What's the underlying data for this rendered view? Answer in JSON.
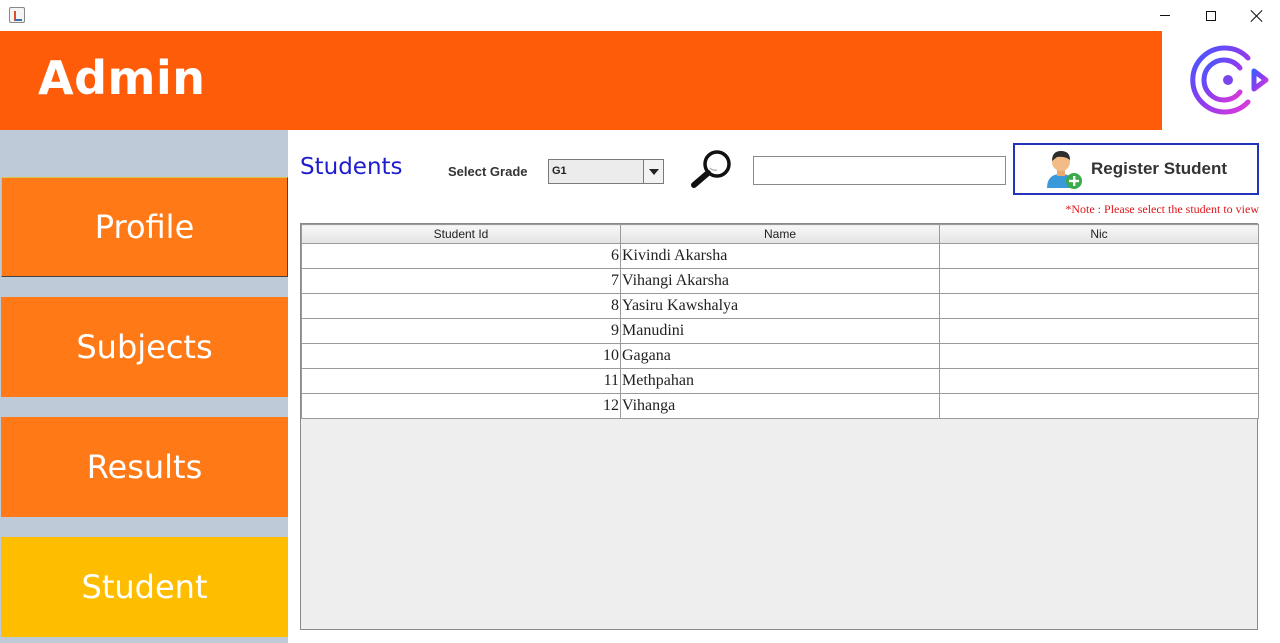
{
  "window": {
    "icon": "java-app-icon",
    "controls": {
      "minimize": "minimize-icon",
      "maximize": "maximize-icon",
      "close": "close-icon"
    }
  },
  "header": {
    "title": "Admin",
    "logo_icon": "logout-icon"
  },
  "sidebar": {
    "items": [
      {
        "label": "Profile",
        "color": "#ff7a16"
      },
      {
        "label": "Subjects",
        "color": "#ff7a16"
      },
      {
        "label": "Results",
        "color": "#ff7a16"
      },
      {
        "label": "Student",
        "color": "#ffbd00"
      }
    ]
  },
  "main": {
    "heading": "Students",
    "grade_label": "Select Grade",
    "grade_value": "G1",
    "search_value": "",
    "register_label": "Register Student",
    "note": "*Note : Please select the student to view"
  },
  "table": {
    "columns": [
      "Student Id",
      "Name",
      "Nic"
    ],
    "rows": [
      {
        "id": "6",
        "name": "Kivindi Akarsha",
        "nic": ""
      },
      {
        "id": "7",
        "name": "Vihangi Akarsha",
        "nic": ""
      },
      {
        "id": "8",
        "name": "Yasiru Kawshalya",
        "nic": ""
      },
      {
        "id": "9",
        "name": "Manudini",
        "nic": ""
      },
      {
        "id": "10",
        "name": "Gagana",
        "nic": ""
      },
      {
        "id": "11",
        "name": "Methpahan",
        "nic": ""
      },
      {
        "id": "12",
        "name": "Vihanga",
        "nic": ""
      }
    ]
  },
  "colors": {
    "header": "#ff5c0a",
    "sidebar_bg": "#bfcad8",
    "heading": "#1d1dcc",
    "note": "#e0161a",
    "register_border": "#2233bb"
  }
}
